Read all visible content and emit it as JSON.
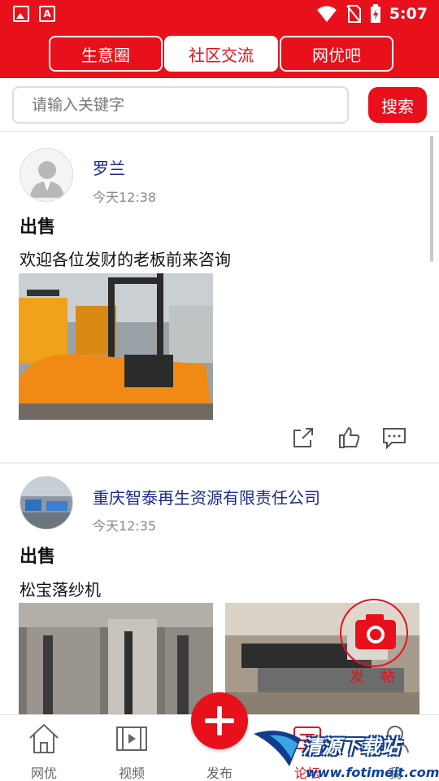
{
  "status_bar": {
    "time": "5:07"
  },
  "header": {
    "tabs": [
      {
        "label": "生意圈",
        "active": false
      },
      {
        "label": "社区交流",
        "active": true
      },
      {
        "label": "网优吧",
        "active": false
      }
    ]
  },
  "search": {
    "placeholder": "请输入关键字",
    "button_label": "搜索"
  },
  "posts": [
    {
      "author": "罗兰",
      "time": "今天12:38",
      "title": "出售",
      "body": "欢迎各位发财的老板前来咨询"
    },
    {
      "author": "重庆智泰再生资源有限责任公司",
      "time": "今天12:35",
      "title": "出售",
      "body": "松宝落纱机"
    }
  ],
  "floating_button": {
    "label": "发帖"
  },
  "bottom_nav": [
    {
      "label": "网优",
      "icon": "home-icon"
    },
    {
      "label": "视频",
      "icon": "video-icon"
    },
    {
      "label": "发布",
      "icon": "plus-icon"
    },
    {
      "label": "论坛",
      "icon": "forum-icon",
      "active": true
    },
    {
      "label": "我",
      "icon": "user-icon"
    }
  ],
  "watermark": {
    "title": "清源下载站",
    "url": "www.fotimeit.com"
  },
  "colors": {
    "accent": "#e8101a",
    "author": "#1c2a8e"
  }
}
